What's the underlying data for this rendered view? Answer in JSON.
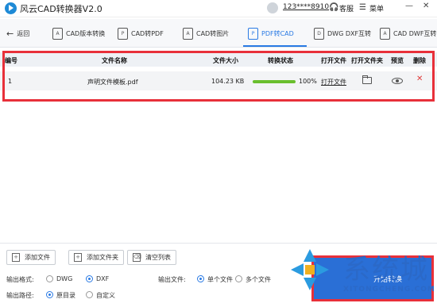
{
  "app": {
    "title": "风云CAD转换器V2.0"
  },
  "titlebar": {
    "user": "123****8910",
    "service_label": "客服",
    "menu_label": "菜单",
    "minimize": "—",
    "close": "✕"
  },
  "toolbar": {
    "back": "返回",
    "items": [
      {
        "label": "CAD版本转换",
        "icon": "A"
      },
      {
        "label": "CAD转PDF",
        "icon": "P"
      },
      {
        "label": "CAD转图片",
        "icon": "A"
      },
      {
        "label": "PDF转CAD",
        "icon": "P"
      },
      {
        "label": "DWG DXF互转",
        "icon": "D"
      },
      {
        "label": "CAD DWF互转",
        "icon": "A"
      }
    ],
    "active_index": 3
  },
  "table": {
    "headers": [
      "编号",
      "文件名称",
      "文件大小",
      "转换状态",
      "打开文件",
      "打开文件夹",
      "预览",
      "删除"
    ],
    "rows": [
      {
        "index": "1",
        "name": "声明文件模板.pdf",
        "size": "104.23 KB",
        "progress_text": "100%",
        "progress": 1.0,
        "open_file": "打开文件"
      }
    ]
  },
  "bottom": {
    "buttons": [
      "添加文件",
      "添加文件夹",
      "清空列表"
    ],
    "output_format_label": "输出格式:",
    "format_options": [
      "DWG",
      "DXF"
    ],
    "format_selected": "DXF",
    "output_file_label": "输出文件:",
    "file_options": [
      "单个文件",
      "多个文件"
    ],
    "file_selected": "单个文件",
    "output_path_label": "输出路径:",
    "path_options": [
      "原目录",
      "自定义"
    ],
    "path_selected": "原目录",
    "start_label": "开始转换"
  },
  "watermark": {
    "text": "系统城",
    "sub": "XITONGCHENG.COM"
  },
  "colors": {
    "accent": "#2a7ae4",
    "progress": "#6abf2e",
    "highlight": "#e8303a",
    "delete": "#e03a3a"
  }
}
